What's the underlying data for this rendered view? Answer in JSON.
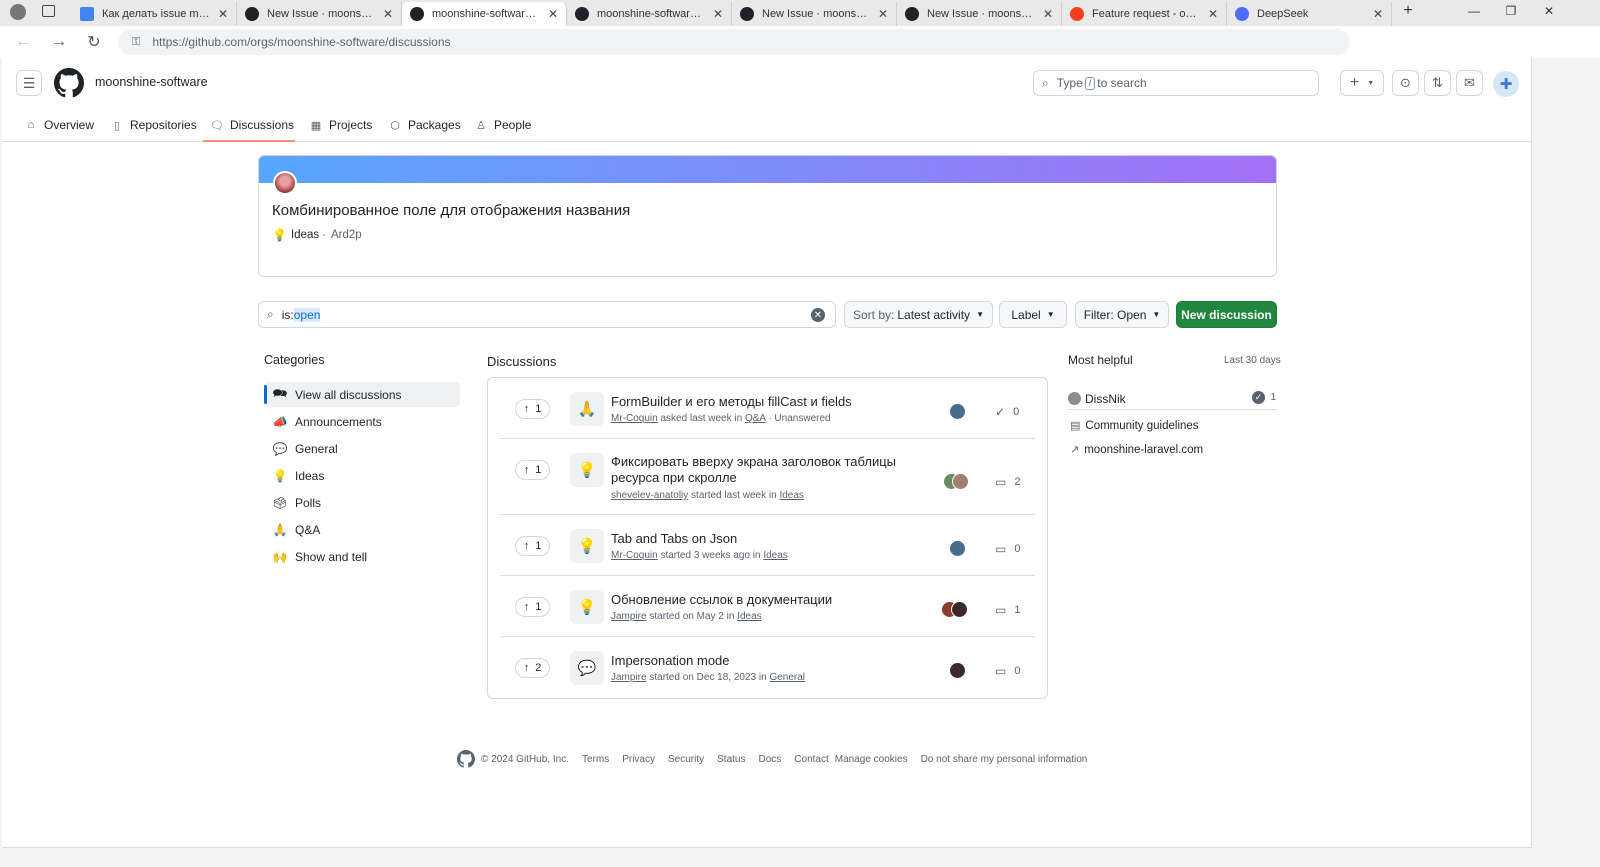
{
  "browser": {
    "tabs": [
      {
        "title": "Как делать issue moonsh",
        "icon_color": "#4285f4"
      },
      {
        "title": "New Issue · moonshine-sc",
        "icon_color": "#1f2328"
      },
      {
        "title": "moonshine-software · Dis",
        "icon_color": "#1f2328"
      },
      {
        "title": "moonshine-software · Dis",
        "icon_color": "#1f2328"
      },
      {
        "title": "New Issue · moonshine-sc",
        "icon_color": "#1f2328"
      },
      {
        "title": "New Issue · moonshine-sc",
        "icon_color": "#1f2328"
      },
      {
        "title": "Feature request - открыт",
        "icon_color": "#fc3f1d"
      },
      {
        "title": "DeepSeek",
        "icon_color": "#4d6bfe"
      }
    ],
    "active_tab_index": 2,
    "url": "https://github.com/orgs/moonshine-software/discussions"
  },
  "header": {
    "org_name": "moonshine-software",
    "search_prefix": "Type",
    "search_key": "/",
    "search_suffix": "to search"
  },
  "orgnav": [
    {
      "label": "Overview",
      "icon": "home-icon"
    },
    {
      "label": "Repositories",
      "icon": "repo-icon"
    },
    {
      "label": "Discussions",
      "icon": "comment-discussion-icon",
      "selected": true
    },
    {
      "label": "Projects",
      "icon": "table-icon"
    },
    {
      "label": "Packages",
      "icon": "package-icon"
    },
    {
      "label": "People",
      "icon": "person-icon"
    }
  ],
  "spotlight": {
    "title": "Комбинированное поле для отображения названия",
    "category": "Ideas",
    "author": "Ard2p"
  },
  "filters": {
    "query_prefix": "is:",
    "query_selected": "open",
    "sort_prefix": "Sort by:",
    "sort_value": "Latest activity",
    "label_btn": "Label",
    "filter_btn": "Filter: Open",
    "new_discussion": "New discussion"
  },
  "categories": {
    "heading": "Categories",
    "items": [
      {
        "label": "View all discussions",
        "emoji": "💬",
        "active": true
      },
      {
        "label": "Announcements",
        "emoji": "📣"
      },
      {
        "label": "General",
        "emoji": "💬"
      },
      {
        "label": "Ideas",
        "emoji": "💡"
      },
      {
        "label": "Polls",
        "emoji": "🗳️"
      },
      {
        "label": "Q&A",
        "emoji": "🙏"
      },
      {
        "label": "Show and tell",
        "emoji": "🙌"
      }
    ]
  },
  "discussions": {
    "heading": "Discussions",
    "items": [
      {
        "votes": "1",
        "emoji": "🙏",
        "title": "FormBuilder и его методы fillCast и fields",
        "user": "Mr-Coquin",
        "verb": "asked last week in",
        "category": "Q&A",
        "extra": "· Unanswered",
        "stat_icon": "check-circle-icon",
        "count": "0"
      },
      {
        "votes": "1",
        "emoji": "💡",
        "title": "Фиксировать вверху экрана заголовок таблицы ресурса при скролле",
        "user": "shevelev-anatoliy",
        "verb": "started last week in",
        "category": "Ideas",
        "extra": "",
        "stat_icon": "comment-icon",
        "count": "2"
      },
      {
        "votes": "1",
        "emoji": "💡",
        "title": "Tab and Tabs on Json",
        "user": "Mr-Coquin",
        "verb": "started 3 weeks ago in",
        "category": "Ideas",
        "extra": "",
        "stat_icon": "comment-icon",
        "count": "0"
      },
      {
        "votes": "1",
        "emoji": "💡",
        "title": "Обновление ссылок в документации",
        "user": "Jampire",
        "verb": "started on May 2 in",
        "category": "Ideas",
        "extra": "",
        "stat_icon": "comment-icon",
        "count": "1"
      },
      {
        "votes": "2",
        "emoji": "💬",
        "title": "Impersonation mode",
        "user": "Jampire",
        "verb": "started on Dec 18, 2023 in",
        "category": "General",
        "extra": "",
        "stat_icon": "comment-icon",
        "count": "0"
      }
    ]
  },
  "helpful": {
    "heading": "Most helpful",
    "range": "Last 30 days",
    "user": "DissNik",
    "user_count": "1",
    "links": [
      {
        "label": "Community guidelines",
        "icon": "book-icon"
      },
      {
        "label": "moonshine-laravel.com",
        "icon": "link-external-icon"
      }
    ]
  },
  "footer": {
    "copyright": "© 2024 GitHub, Inc.",
    "links": [
      "Terms",
      "Privacy",
      "Security",
      "Status",
      "Docs",
      "Contact",
      "Manage cookies",
      "Do not share my personal information"
    ]
  }
}
